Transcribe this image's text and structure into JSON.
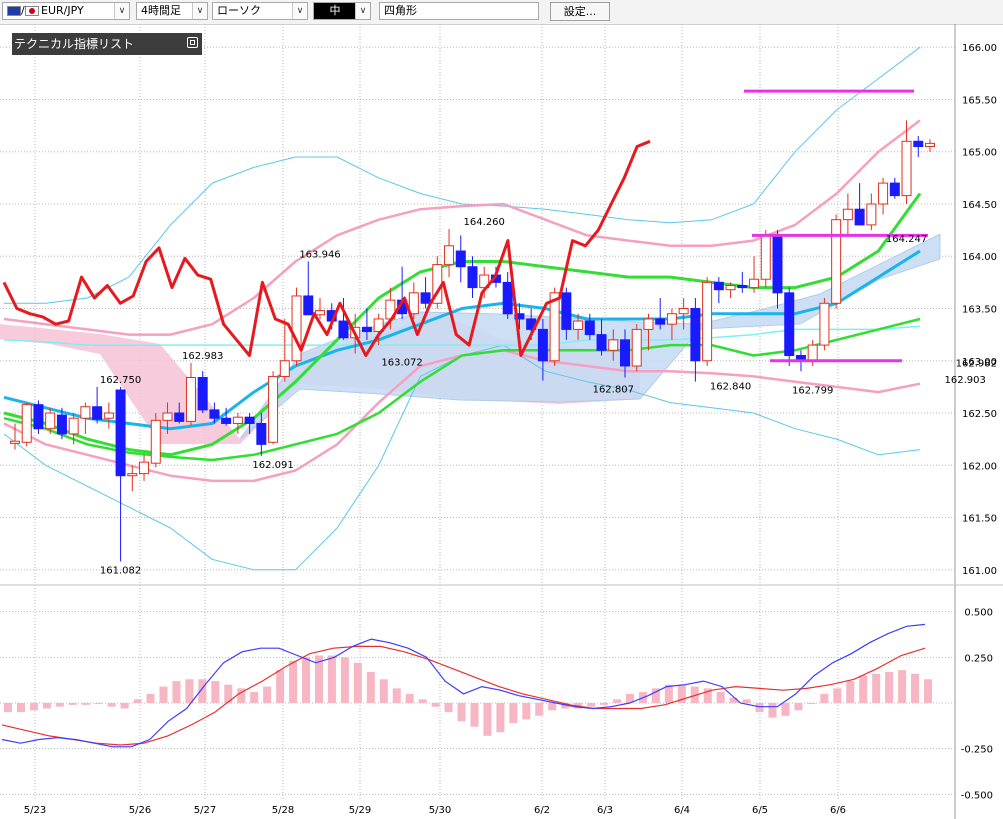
{
  "toolbar": {
    "symbol": "EUR/JPY",
    "timeframe": "4時間足",
    "chart_type": "ローソク",
    "draw_size": "中",
    "draw_shape": "四角形",
    "settings_label": "設定..."
  },
  "indicator_list_label": "テクニカル指標リスト",
  "colors": {
    "bull_candle": "#ffffff",
    "bull_outline": "#e0301e",
    "bear_candle": "#1a1aff",
    "rsi_line": "#e8191e",
    "bollinger_outer": "#5bc8e8",
    "bollinger_inner": "#f5a0c0",
    "ichimoku_cloud": "#c8dcf4",
    "macd_line": "#3c3cff",
    "signal_line": "#e83030",
    "histogram": "#f7b6c3",
    "sma_short": "#33dd33",
    "sma_mid": "#1ab4e8",
    "hline": "#e633e6"
  },
  "chart_data": [
    {
      "type": "candlestick",
      "title": "",
      "y_ticks": [
        "166.00",
        "165.50",
        "165.00",
        "164.50",
        "164.00",
        "163.50",
        "163.00",
        "162.50",
        "162.00",
        "161.50",
        "161.00"
      ],
      "ylim": [
        160.95,
        166.05
      ],
      "x_ticks": [
        "5/23",
        "5/26",
        "5/27",
        "5/28",
        "5/29",
        "5/30",
        "6/2",
        "6/3",
        "6/4",
        "6/5",
        "6/6"
      ],
      "current_price": "162.982",
      "annotations": [
        {
          "label": "162.750",
          "x": 9,
          "y": 162.75
        },
        {
          "label": "161.082",
          "x": 9,
          "y": 161.08
        },
        {
          "label": "162.983",
          "x": 16,
          "y": 162.98
        },
        {
          "label": "162.091",
          "x": 22,
          "y": 162.09
        },
        {
          "label": "163.946",
          "x": 26,
          "y": 163.95
        },
        {
          "label": "163.072",
          "x": 33,
          "y": 163.07
        },
        {
          "label": "164.260",
          "x": 40,
          "y": 164.26
        },
        {
          "label": "162.807",
          "x": 51,
          "y": 162.81
        },
        {
          "label": "162.840",
          "x": 61,
          "y": 162.84
        },
        {
          "label": "162.799",
          "x": 68,
          "y": 162.8
        },
        {
          "label": "164.247",
          "x": 76,
          "y": 164.25
        },
        {
          "label": "162.903",
          "x": 81,
          "y": 162.9
        }
      ],
      "candles": [
        {
          "o": 162.21,
          "h": 162.4,
          "l": 162.15,
          "c": 162.23
        },
        {
          "o": 162.22,
          "h": 162.6,
          "l": 162.18,
          "c": 162.58
        },
        {
          "o": 162.58,
          "h": 162.62,
          "l": 162.3,
          "c": 162.35
        },
        {
          "o": 162.35,
          "h": 162.55,
          "l": 162.3,
          "c": 162.5
        },
        {
          "o": 162.48,
          "h": 162.55,
          "l": 162.25,
          "c": 162.3
        },
        {
          "o": 162.3,
          "h": 162.5,
          "l": 162.2,
          "c": 162.45
        },
        {
          "o": 162.45,
          "h": 162.6,
          "l": 162.3,
          "c": 162.56
        },
        {
          "o": 162.56,
          "h": 162.75,
          "l": 162.4,
          "c": 162.44
        },
        {
          "o": 162.45,
          "h": 162.6,
          "l": 162.35,
          "c": 162.5
        },
        {
          "o": 162.72,
          "h": 162.75,
          "l": 161.08,
          "c": 161.9
        },
        {
          "o": 161.9,
          "h": 162.0,
          "l": 161.75,
          "c": 161.92
        },
        {
          "o": 161.92,
          "h": 162.1,
          "l": 161.85,
          "c": 162.03
        },
        {
          "o": 162.02,
          "h": 162.5,
          "l": 161.98,
          "c": 162.43
        },
        {
          "o": 162.43,
          "h": 162.6,
          "l": 162.3,
          "c": 162.5
        },
        {
          "o": 162.5,
          "h": 162.6,
          "l": 162.4,
          "c": 162.42
        },
        {
          "o": 162.42,
          "h": 162.98,
          "l": 162.38,
          "c": 162.84
        },
        {
          "o": 162.84,
          "h": 162.9,
          "l": 162.5,
          "c": 162.53
        },
        {
          "o": 162.53,
          "h": 162.6,
          "l": 162.4,
          "c": 162.45
        },
        {
          "o": 162.45,
          "h": 162.55,
          "l": 162.38,
          "c": 162.4
        },
        {
          "o": 162.4,
          "h": 162.5,
          "l": 162.3,
          "c": 162.46
        },
        {
          "o": 162.46,
          "h": 162.5,
          "l": 162.3,
          "c": 162.4
        },
        {
          "o": 162.4,
          "h": 162.5,
          "l": 162.09,
          "c": 162.2
        },
        {
          "o": 162.22,
          "h": 162.9,
          "l": 162.2,
          "c": 162.85
        },
        {
          "o": 162.85,
          "h": 163.4,
          "l": 162.8,
          "c": 163.0
        },
        {
          "o": 163.0,
          "h": 163.7,
          "l": 162.95,
          "c": 163.62
        },
        {
          "o": 163.62,
          "h": 163.95,
          "l": 163.45,
          "c": 163.44
        },
        {
          "o": 163.44,
          "h": 163.6,
          "l": 163.4,
          "c": 163.48
        },
        {
          "o": 163.48,
          "h": 163.55,
          "l": 163.3,
          "c": 163.38
        },
        {
          "o": 163.38,
          "h": 163.6,
          "l": 163.2,
          "c": 163.22
        },
        {
          "o": 163.22,
          "h": 163.45,
          "l": 163.07,
          "c": 163.32
        },
        {
          "o": 163.32,
          "h": 163.5,
          "l": 163.2,
          "c": 163.28
        },
        {
          "o": 163.28,
          "h": 163.45,
          "l": 163.15,
          "c": 163.4
        },
        {
          "o": 163.4,
          "h": 163.7,
          "l": 163.3,
          "c": 163.58
        },
        {
          "o": 163.58,
          "h": 163.9,
          "l": 163.4,
          "c": 163.45
        },
        {
          "o": 163.45,
          "h": 163.75,
          "l": 163.4,
          "c": 163.65
        },
        {
          "o": 163.65,
          "h": 163.8,
          "l": 163.5,
          "c": 163.55
        },
        {
          "o": 163.55,
          "h": 164.0,
          "l": 163.5,
          "c": 163.92
        },
        {
          "o": 163.92,
          "h": 164.26,
          "l": 163.8,
          "c": 164.1
        },
        {
          "o": 164.05,
          "h": 164.2,
          "l": 163.75,
          "c": 163.9
        },
        {
          "o": 163.9,
          "h": 164.0,
          "l": 163.6,
          "c": 163.7
        },
        {
          "o": 163.7,
          "h": 163.9,
          "l": 163.6,
          "c": 163.82
        },
        {
          "o": 163.82,
          "h": 163.9,
          "l": 163.7,
          "c": 163.75
        },
        {
          "o": 163.75,
          "h": 163.85,
          "l": 163.4,
          "c": 163.45
        },
        {
          "o": 163.45,
          "h": 163.55,
          "l": 163.3,
          "c": 163.4
        },
        {
          "o": 163.4,
          "h": 163.5,
          "l": 163.2,
          "c": 163.3
        },
        {
          "o": 163.3,
          "h": 163.4,
          "l": 162.81,
          "c": 163.0
        },
        {
          "o": 163.0,
          "h": 163.7,
          "l": 162.95,
          "c": 163.65
        },
        {
          "o": 163.65,
          "h": 163.7,
          "l": 163.2,
          "c": 163.3
        },
        {
          "o": 163.3,
          "h": 163.45,
          "l": 163.2,
          "c": 163.38
        },
        {
          "o": 163.38,
          "h": 163.45,
          "l": 163.2,
          "c": 163.25
        },
        {
          "o": 163.25,
          "h": 163.4,
          "l": 163.05,
          "c": 163.1
        },
        {
          "o": 163.1,
          "h": 163.3,
          "l": 163.0,
          "c": 163.2
        },
        {
          "o": 163.2,
          "h": 163.3,
          "l": 162.84,
          "c": 162.95
        },
        {
          "o": 162.95,
          "h": 163.35,
          "l": 162.9,
          "c": 163.3
        },
        {
          "o": 163.3,
          "h": 163.45,
          "l": 163.1,
          "c": 163.4
        },
        {
          "o": 163.4,
          "h": 163.6,
          "l": 163.3,
          "c": 163.35
        },
        {
          "o": 163.35,
          "h": 163.5,
          "l": 163.2,
          "c": 163.45
        },
        {
          "o": 163.45,
          "h": 163.6,
          "l": 163.3,
          "c": 163.5
        },
        {
          "o": 163.5,
          "h": 163.6,
          "l": 162.8,
          "c": 163.0
        },
        {
          "o": 163.0,
          "h": 163.8,
          "l": 162.95,
          "c": 163.75
        },
        {
          "o": 163.75,
          "h": 163.8,
          "l": 163.55,
          "c": 163.68
        },
        {
          "o": 163.68,
          "h": 163.75,
          "l": 163.6,
          "c": 163.72
        },
        {
          "o": 163.72,
          "h": 163.85,
          "l": 163.65,
          "c": 163.7
        },
        {
          "o": 163.7,
          "h": 164.0,
          "l": 163.65,
          "c": 163.78
        },
        {
          "o": 163.78,
          "h": 164.25,
          "l": 163.7,
          "c": 164.2
        },
        {
          "o": 164.2,
          "h": 164.25,
          "l": 163.5,
          "c": 163.65
        },
        {
          "o": 163.65,
          "h": 163.7,
          "l": 162.95,
          "c": 163.05
        },
        {
          "o": 163.05,
          "h": 163.1,
          "l": 162.9,
          "c": 163.0
        },
        {
          "o": 163.0,
          "h": 163.2,
          "l": 162.95,
          "c": 163.15
        },
        {
          "o": 163.15,
          "h": 163.6,
          "l": 163.1,
          "c": 163.55
        },
        {
          "o": 163.55,
          "h": 164.4,
          "l": 163.5,
          "c": 164.35
        },
        {
          "o": 164.35,
          "h": 164.6,
          "l": 164.2,
          "c": 164.45
        },
        {
          "o": 164.45,
          "h": 164.7,
          "l": 164.3,
          "c": 164.3
        },
        {
          "o": 164.3,
          "h": 164.6,
          "l": 164.25,
          "c": 164.5
        },
        {
          "o": 164.5,
          "h": 164.75,
          "l": 164.4,
          "c": 164.7
        },
        {
          "o": 164.7,
          "h": 164.75,
          "l": 164.55,
          "c": 164.58
        },
        {
          "o": 164.58,
          "h": 165.3,
          "l": 164.5,
          "c": 165.1
        },
        {
          "o": 165.1,
          "h": 165.15,
          "l": 164.95,
          "c": 165.05
        },
        {
          "o": 165.05,
          "h": 165.12,
          "l": 165.0,
          "c": 165.08
        }
      ],
      "rsi": [
        163.75,
        163.5,
        163.45,
        163.42,
        163.35,
        163.38,
        163.8,
        163.6,
        163.72,
        163.55,
        163.62,
        163.95,
        164.08,
        163.7,
        163.98,
        163.82,
        163.78,
        163.35,
        163.2,
        163.05,
        163.75,
        163.4,
        163.35,
        163.1,
        163.45,
        163.25,
        163.55,
        163.3,
        163.05,
        163.25,
        163.4,
        163.6,
        163.25,
        163.55,
        163.75,
        163.25,
        163.15,
        163.65,
        163.8,
        164.15,
        163.05,
        163.3,
        163.55,
        163.6,
        164.15,
        164.1,
        164.25,
        164.5,
        164.75,
        165.05,
        165.1
      ],
      "bb_outer_up": [
        163.55,
        163.55,
        163.6,
        163.8,
        164.3,
        164.7,
        164.85,
        164.95,
        164.95,
        164.75,
        164.6,
        164.5,
        164.48,
        164.45,
        164.4,
        164.35,
        164.32,
        164.35,
        164.5,
        165.0,
        165.4,
        165.7,
        166.0
      ],
      "bb_inner_up": [
        163.4,
        163.35,
        163.3,
        163.25,
        163.25,
        163.35,
        163.6,
        163.95,
        164.2,
        164.35,
        164.45,
        164.48,
        164.5,
        164.35,
        164.2,
        164.15,
        164.1,
        164.1,
        164.15,
        164.3,
        164.6,
        165.0,
        165.3
      ],
      "bb_inner_dn": [
        162.4,
        162.2,
        162.1,
        162.0,
        161.9,
        161.85,
        161.85,
        161.95,
        162.2,
        162.6,
        162.95,
        163.05,
        163.1,
        163.0,
        162.95,
        162.9,
        162.9,
        162.88,
        162.85,
        162.8,
        162.75,
        162.7,
        162.78
      ],
      "bb_outer_dn": [
        162.3,
        162.0,
        161.8,
        161.6,
        161.4,
        161.1,
        161.0,
        161.0,
        161.4,
        162.0,
        162.85,
        163.05,
        163.15,
        162.9,
        162.8,
        162.72,
        162.6,
        162.55,
        162.5,
        162.35,
        162.25,
        162.1,
        162.15
      ],
      "sma_short": [
        162.5,
        162.4,
        162.25,
        162.15,
        162.1,
        162.2,
        162.45,
        162.8,
        163.2,
        163.6,
        163.85,
        163.95,
        163.95,
        163.9,
        163.85,
        163.8,
        163.8,
        163.75,
        163.7,
        163.7,
        163.8,
        164.05,
        164.6
      ],
      "sma_mid": [
        162.65,
        162.55,
        162.45,
        162.4,
        162.35,
        162.4,
        162.7,
        162.95,
        163.1,
        163.2,
        163.35,
        163.5,
        163.55,
        163.5,
        163.4,
        163.4,
        163.4,
        163.45,
        163.45,
        163.45,
        163.55,
        163.8,
        164.05
      ],
      "sma_long": [
        162.45,
        162.35,
        162.2,
        162.12,
        162.08,
        162.05,
        162.1,
        162.2,
        162.3,
        162.5,
        162.8,
        163.05,
        163.1,
        163.1,
        163.1,
        163.1,
        163.15,
        163.15,
        163.05,
        163.1,
        163.2,
        163.3,
        163.4
      ],
      "base_line": [
        163.2,
        163.18,
        163.15,
        163.15,
        163.15,
        163.15,
        163.15,
        163.15,
        163.15,
        163.15,
        163.15,
        163.15,
        163.15,
        163.15,
        163.2,
        163.2,
        163.2,
        163.22,
        163.25,
        163.3,
        163.3,
        163.3,
        163.33
      ],
      "hlines": [
        165.58,
        164.2,
        163.0
      ],
      "volume": []
    },
    {
      "type": "macd",
      "y_ticks": [
        "0.500",
        "0.250",
        "",
        "-0.250",
        "-0.500"
      ],
      "ylim": [
        -0.52,
        0.52
      ],
      "histogram": [
        -0.05,
        -0.05,
        -0.04,
        -0.03,
        -0.02,
        -0.01,
        -0.01,
        0.0,
        -0.02,
        -0.03,
        0.02,
        0.05,
        0.09,
        0.12,
        0.13,
        0.13,
        0.12,
        0.1,
        0.08,
        0.06,
        0.09,
        0.18,
        0.23,
        0.25,
        0.26,
        0.26,
        0.25,
        0.22,
        0.17,
        0.13,
        0.08,
        0.05,
        0.02,
        -0.02,
        -0.05,
        -0.1,
        -0.13,
        -0.18,
        -0.16,
        -0.11,
        -0.09,
        -0.07,
        -0.04,
        -0.03,
        -0.03,
        -0.02,
        -0.01,
        0.02,
        0.05,
        0.06,
        0.08,
        0.1,
        0.1,
        0.09,
        0.08,
        0.06,
        0.03,
        0.02,
        -0.05,
        -0.08,
        -0.07,
        -0.04,
        0.0,
        0.05,
        0.08,
        0.12,
        0.15,
        0.16,
        0.17,
        0.18,
        0.16,
        0.13
      ],
      "macd": [
        -0.2,
        -0.22,
        -0.2,
        -0.19,
        -0.2,
        -0.22,
        -0.24,
        -0.24,
        -0.2,
        -0.1,
        -0.03,
        0.1,
        0.22,
        0.28,
        0.3,
        0.3,
        0.26,
        0.22,
        0.25,
        0.31,
        0.35,
        0.33,
        0.3,
        0.25,
        0.12,
        0.05,
        0.09,
        0.07,
        0.04,
        0.02,
        0.0,
        -0.02,
        -0.03,
        -0.02,
        0.0,
        0.04,
        0.09,
        0.1,
        0.12,
        0.09,
        0.0,
        -0.02,
        -0.02,
        0.05,
        0.15,
        0.22,
        0.27,
        0.33,
        0.38,
        0.42,
        0.43
      ],
      "signal": [
        -0.12,
        -0.15,
        -0.18,
        -0.2,
        -0.22,
        -0.23,
        -0.22,
        -0.18,
        -0.12,
        -0.05,
        0.05,
        0.12,
        0.2,
        0.27,
        0.3,
        0.31,
        0.31,
        0.28,
        0.24,
        0.19,
        0.14,
        0.09,
        0.05,
        0.02,
        -0.01,
        -0.03,
        -0.03,
        -0.03,
        -0.01,
        0.03,
        0.07,
        0.09,
        0.08,
        0.07,
        0.08,
        0.1,
        0.13,
        0.19,
        0.26,
        0.3
      ]
    }
  ]
}
